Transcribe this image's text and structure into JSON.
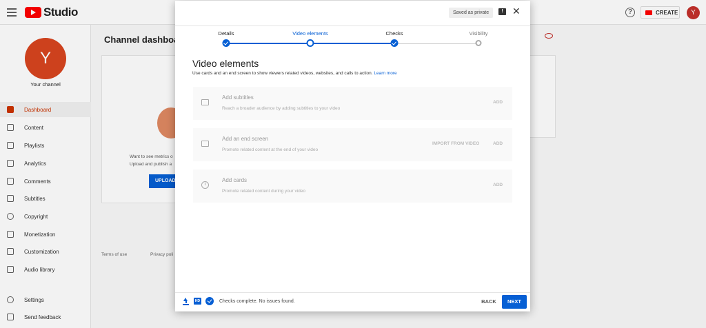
{
  "app": {
    "logo_text": "Studio",
    "create_label": "CREATE",
    "avatar_letter": "Y",
    "accent_color": "#065fd4",
    "brand_color": "#ff0000"
  },
  "sidebar": {
    "avatar_letter": "Y",
    "channel_label": "Your channel",
    "items": [
      {
        "label": "Dashboard",
        "icon": "dashboard-icon",
        "active": true
      },
      {
        "label": "Content",
        "icon": "content-icon"
      },
      {
        "label": "Playlists",
        "icon": "playlists-icon"
      },
      {
        "label": "Analytics",
        "icon": "analytics-icon"
      },
      {
        "label": "Comments",
        "icon": "comments-icon"
      },
      {
        "label": "Subtitles",
        "icon": "subtitles-icon"
      },
      {
        "label": "Copyright",
        "icon": "copyright-icon"
      },
      {
        "label": "Monetization",
        "icon": "monetization-icon"
      },
      {
        "label": "Customization",
        "icon": "customization-icon"
      },
      {
        "label": "Audio library",
        "icon": "audio-library-icon"
      }
    ],
    "bottom_items": [
      {
        "label": "Settings",
        "icon": "gear-icon"
      },
      {
        "label": "Send feedback",
        "icon": "feedback-icon"
      }
    ]
  },
  "background": {
    "title": "Channel dashboar",
    "card_line1": "Want to see metrics o",
    "card_line2": "Upload and publish a",
    "upload_button": "UPLOAD",
    "footer_links": [
      "Terms of use",
      "Privacy poli"
    ]
  },
  "dialog": {
    "saved_badge": "Saved as private",
    "steps": [
      {
        "label": "Details",
        "state": "done"
      },
      {
        "label": "Video elements",
        "state": "current"
      },
      {
        "label": "Checks",
        "state": "done"
      },
      {
        "label": "Visibility",
        "state": "pending"
      }
    ],
    "title": "Video elements",
    "description": "Use cards and an end screen to show viewers related videos, websites, and calls to action.",
    "learn_more": "Learn more",
    "options": [
      {
        "title": "Add subtitles",
        "subtitle": "Reach a broader audience by adding subtitles to your video",
        "icon": "subtitles-icon",
        "actions": [
          "ADD"
        ]
      },
      {
        "title": "Add an end screen",
        "subtitle": "Promote related content at the end of your video",
        "icon": "end-screen-icon",
        "actions": [
          "IMPORT FROM VIDEO",
          "ADD"
        ]
      },
      {
        "title": "Add cards",
        "subtitle": "Promote related content during your video",
        "icon": "info-icon",
        "actions": [
          "ADD"
        ]
      }
    ],
    "footer": {
      "hd_label": "HD",
      "status": "Checks complete. No issues found.",
      "back": "BACK",
      "next": "NEXT"
    }
  }
}
